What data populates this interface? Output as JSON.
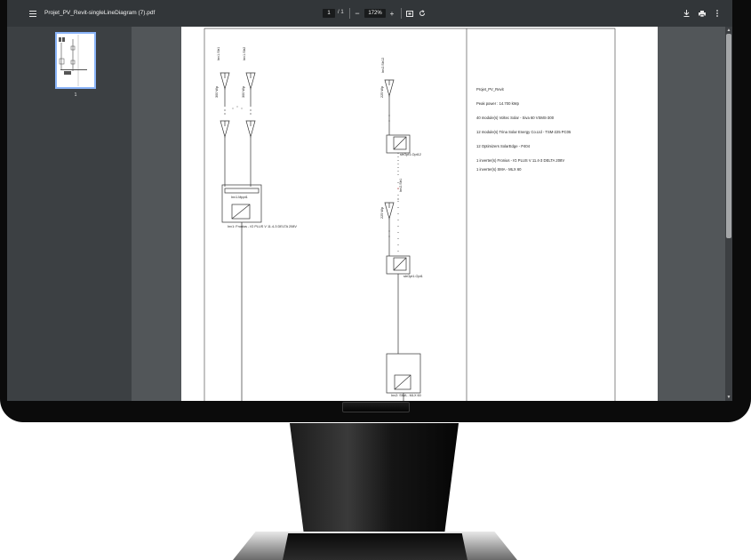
{
  "toolbar": {
    "menu_icon": "menu-icon",
    "title": "Projet_PV_Revit-singleLineDiagram (7).pdf",
    "page_current": "1",
    "page_total_text": "/  1",
    "zoom_out": "−",
    "zoom": "172%",
    "zoom_in": "+",
    "fit_icon": "fit-page-icon",
    "rotate_icon": "rotate-icon",
    "download_icon": "download-icon",
    "print_icon": "print-icon",
    "more_icon": "more-vertical-icon"
  },
  "sidebar": {
    "thumbnail_page": "1"
  },
  "diagram": {
    "string_a": "Inv1.Str1",
    "string_b": "Inv1.Str2",
    "string_c": "Inv2.Str12",
    "string_d": "Inv2.Str1",
    "module_a": "300 Wp",
    "module_b": "300 Wp",
    "module_c": "225 Wp",
    "module_d": "225 Wp",
    "mppt": "Inv1.Mppt1",
    "inverter1": "Inv1: Fronius - IG PLUS V 11.4-3 DELTA 208V",
    "optimizer12": "strOpt1.Opt12",
    "optimizer1": "strOpt1.Opt1",
    "inverter2": "Inv2: SMA - MLX 60",
    "dots": ". . ."
  },
  "info": {
    "project": "Projet_PV_Revit",
    "peak_power": "Peak power : 14.700 kWp",
    "modules1": "40 module(s) Voltec Solar - Siva 60 VSMS-300",
    "modules2": "12 module(s) Trina Solar Energy Co.Ltd - TSM-225 PC05",
    "optimizers": "12 Optimizers SolarEdge - P404",
    "inverter1": "1 inverter(s) Fronius - IG PLUS V 11.4-3 DELTA 208V",
    "inverter2": "1 inverter(s) SMA - MLX 60"
  }
}
